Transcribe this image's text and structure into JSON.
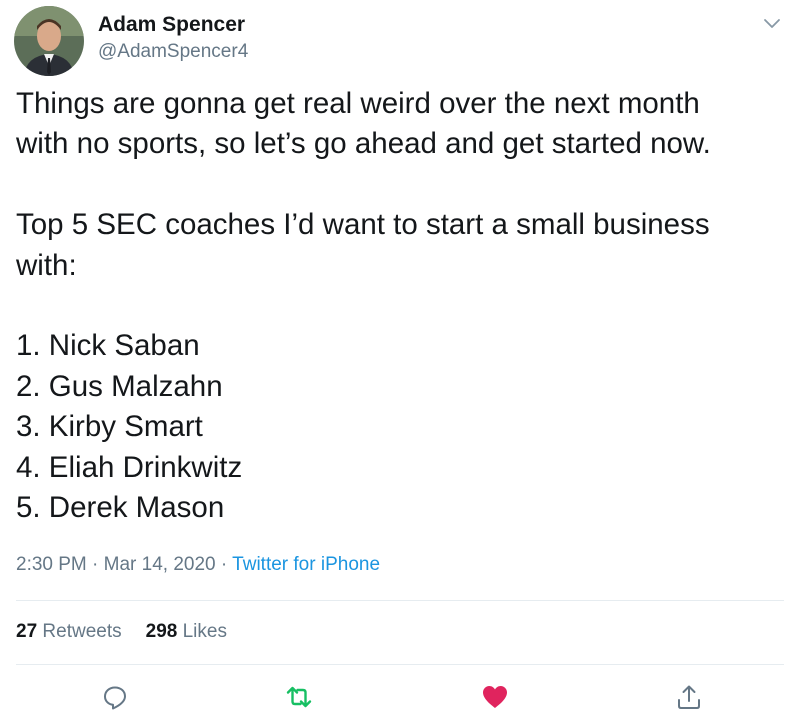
{
  "author": {
    "name": "Adam Spencer",
    "handle": "@AdamSpencer4"
  },
  "tweet": {
    "lines": [
      "Things are gonna get real weird over the next month",
      "with no sports, so let’s go ahead and get started now.",
      "",
      "Top 5 SEC coaches I’d want to start a small business",
      "with:",
      "",
      "1. Nick Saban",
      "2. Gus Malzahn",
      "3. Kirby Smart",
      "4. Eliah Drinkwitz",
      "5. Derek Mason"
    ]
  },
  "meta": {
    "time": "2:30 PM",
    "separator": "·",
    "date": "Mar 14, 2020",
    "source": "Twitter for iPhone"
  },
  "stats": {
    "retweets_count": "27",
    "retweets_label": "Retweets",
    "likes_count": "298",
    "likes_label": "Likes"
  },
  "actions": {
    "reply_icon": "reply-icon",
    "retweet_icon": "retweet-icon",
    "like_icon": "heart-icon",
    "share_icon": "share-icon",
    "retweet_color": "#17bf63",
    "like_color": "#e0245e",
    "default_color": "#657786"
  }
}
